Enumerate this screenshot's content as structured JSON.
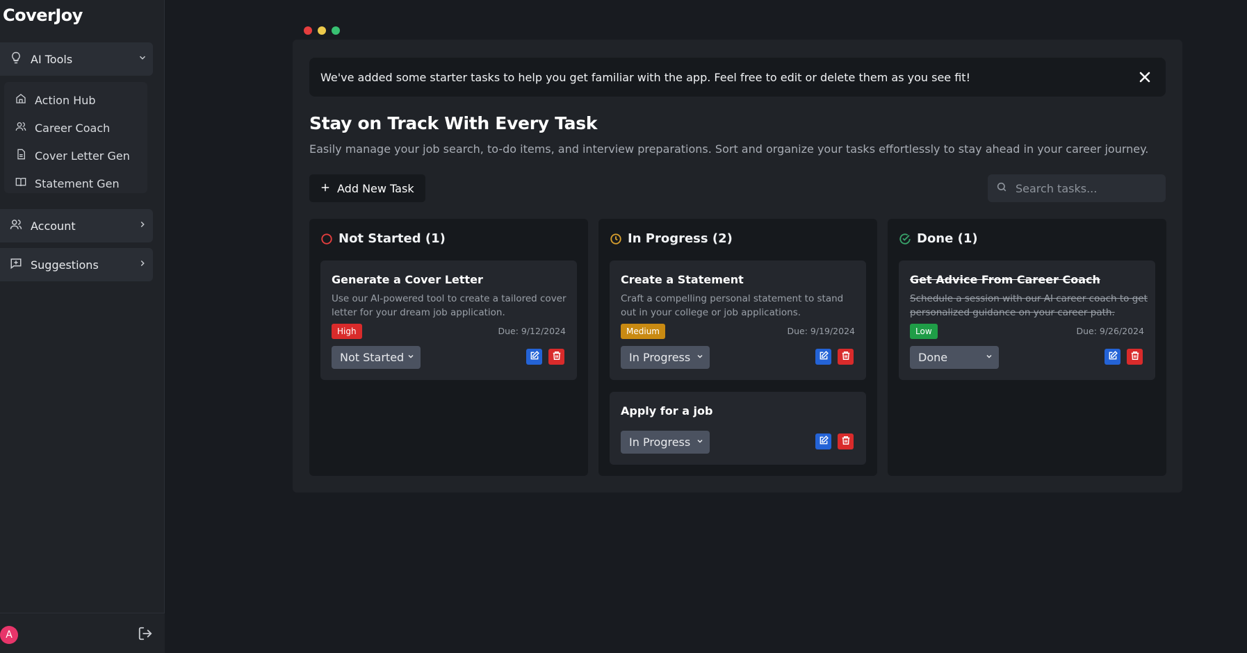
{
  "sidebar": {
    "brand": "CoverJoy",
    "ai_tools_label": "AI Tools",
    "ai_items": [
      {
        "label": "Action Hub",
        "icon": "home-icon"
      },
      {
        "label": "Career Coach",
        "icon": "users-icon"
      },
      {
        "label": "Cover Letter Gen",
        "icon": "document-icon"
      },
      {
        "label": "Statement Gen",
        "icon": "book-icon"
      }
    ],
    "account_label": "Account",
    "suggestions_label": "Suggestions",
    "avatar_initial": "A"
  },
  "notice": {
    "text": "We've added some starter tasks to help you get familiar with the app. Feel free to edit or delete them as you see fit!"
  },
  "header": {
    "title": "Stay on Track With Every Task",
    "subtitle": "Easily manage your job search, to-do items, and interview preparations. Sort and organize your tasks effortlessly to stay ahead in your career journey."
  },
  "toolbar": {
    "add_label": "Add New Task",
    "search_placeholder": "Search tasks..."
  },
  "columns": [
    {
      "title": "Not Started (1)",
      "color": "#e53e3e",
      "cards": [
        {
          "title": "Generate a Cover Letter",
          "description": "Use our AI-powered tool to create a tailored cover letter for your dream job application.",
          "priority": "High",
          "priority_color": "#d92b2b",
          "due": "Due: 9/12/2024",
          "status": "Not Started"
        }
      ]
    },
    {
      "title": "In Progress (2)",
      "color": "#d69e2e",
      "cards": [
        {
          "title": "Create a Statement",
          "description": "Craft a compelling personal statement to stand out in your college or job applications.",
          "priority": "Medium",
          "priority_color": "#c98a12",
          "due": "Due: 9/19/2024",
          "status": "In Progress"
        },
        {
          "title": "Apply for a job",
          "status": "In Progress"
        }
      ]
    },
    {
      "title": "Done (1)",
      "color": "#38a169",
      "cards": [
        {
          "title": "Get Advice From Career Coach",
          "description": "Schedule a session with our AI career coach to get personalized guidance on your career path.",
          "priority": "Low",
          "priority_color": "#1f9d47",
          "due": "Due: 9/26/2024",
          "status": "Done"
        }
      ]
    }
  ]
}
